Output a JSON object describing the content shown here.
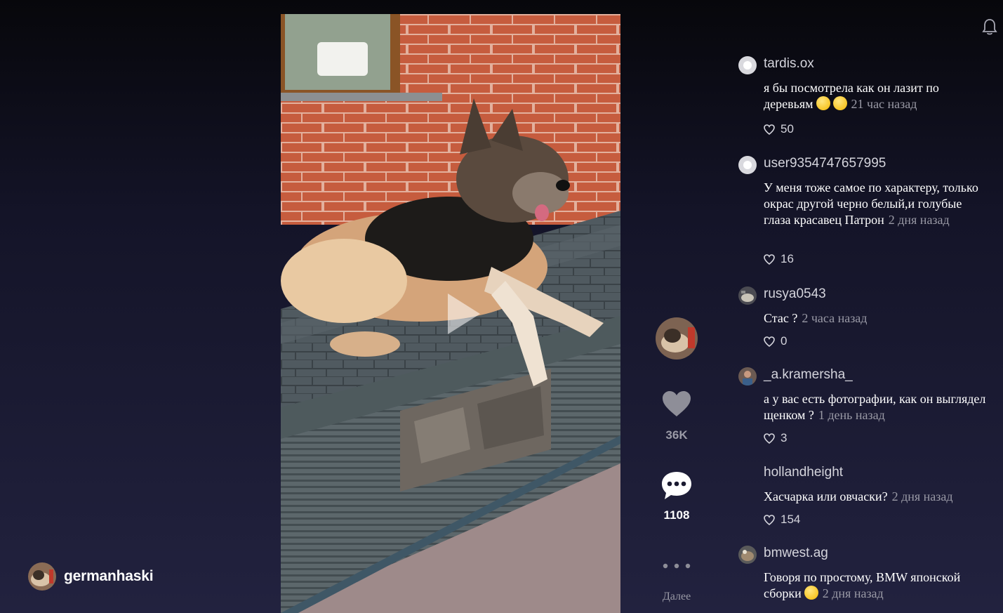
{
  "video": {
    "play_icon": "play-icon"
  },
  "header": {
    "notifications_icon": "bell-icon"
  },
  "author": {
    "username": "germanhaski"
  },
  "actions": {
    "likes": "36K",
    "comments": "1108",
    "more_label": "Далее",
    "icons": [
      "heart-icon",
      "comment-bubble-icon",
      "more-dots-icon"
    ]
  },
  "comments": [
    {
      "user": "tardis.ox",
      "text": "я бы посмотрела как он лазит по деревьям",
      "emojis": [
        "flushed-face-emoji",
        "grinning-face-emoji"
      ],
      "time": "21 час назад",
      "likes": "50"
    },
    {
      "user": "user9354747657995",
      "text": "У меня тоже самое по характеру, только окрас другой черно белый,и голубые глаза красавец Патрон",
      "time": "2 дня назад",
      "likes": "16"
    },
    {
      "user": "rusya0543",
      "text": "Стас ?",
      "time": "2 часа назад",
      "likes": "0"
    },
    {
      "user": "_a.kramersha_",
      "text": "а у вас есть фотографии, как он выглядел щенком ?",
      "time": "1 день назад",
      "likes": "3"
    },
    {
      "user": "hollandheight",
      "text": "Хасчарка или овчаски?",
      "time": "2 дня назад",
      "likes": "154"
    },
    {
      "user": "bmwest.ag",
      "text": "Говоря по простому, BMW японской сборки",
      "emojis": [
        "squinting-face-emoji"
      ],
      "time": "2 дня назад"
    }
  ],
  "colors": {
    "brick": "#c3573a",
    "roof": "#4a5358",
    "muted_text": "#9a9aa6"
  }
}
